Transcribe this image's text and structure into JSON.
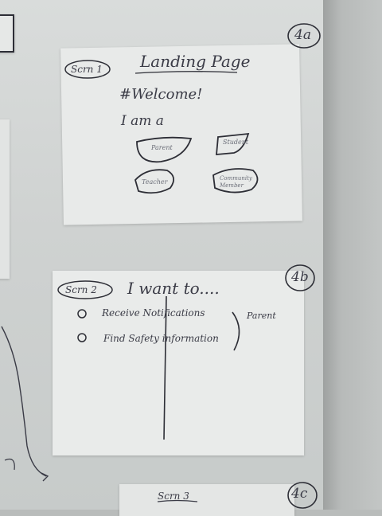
{
  "board": {
    "page_markers": [
      "4a",
      "4b",
      "4c"
    ]
  },
  "screen1": {
    "tag": "Scrn 1",
    "title": "Landing Page",
    "welcome": "#Welcome!",
    "prompt": "I am a",
    "buttons": [
      "Parent",
      "Student",
      "Teacher",
      "Community Member"
    ]
  },
  "screen2": {
    "tag": "Scrn 2",
    "title": "I want to....",
    "options": [
      "Receive Notifications",
      "Find Safety information"
    ],
    "bracket_label": "Parent"
  },
  "screen3": {
    "tag": "Scrn 3"
  }
}
